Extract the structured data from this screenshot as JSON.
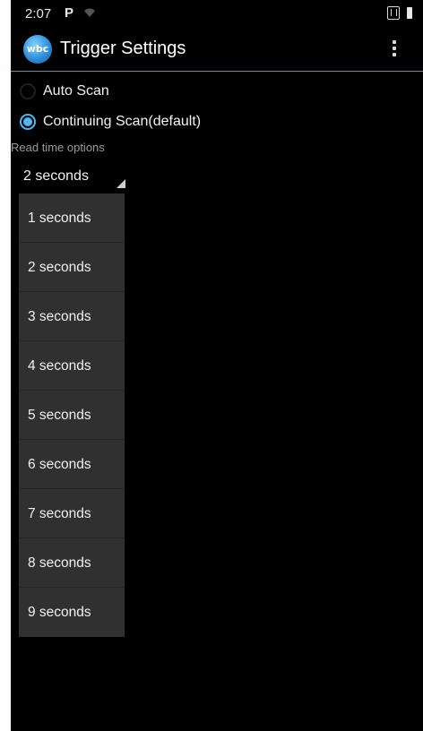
{
  "status_bar": {
    "time": "2:07",
    "p_icon": "P"
  },
  "app_bar": {
    "logo_text": "wbc",
    "title": "Trigger Settings",
    "accent_color": "#2e9fd8"
  },
  "scan_mode": {
    "options": [
      {
        "label": "Auto Scan",
        "selected": false
      },
      {
        "label": "Continuing Scan(default)",
        "selected": true
      }
    ],
    "radio_accent_color": "#4fb6ee"
  },
  "read_time": {
    "section_label": "Read time options",
    "selected_value": "2 seconds",
    "options": [
      "1 seconds",
      "2 seconds",
      "3 seconds",
      "4 seconds",
      "5 seconds",
      "6 seconds",
      "7 seconds",
      "8 seconds",
      "9 seconds"
    ]
  }
}
